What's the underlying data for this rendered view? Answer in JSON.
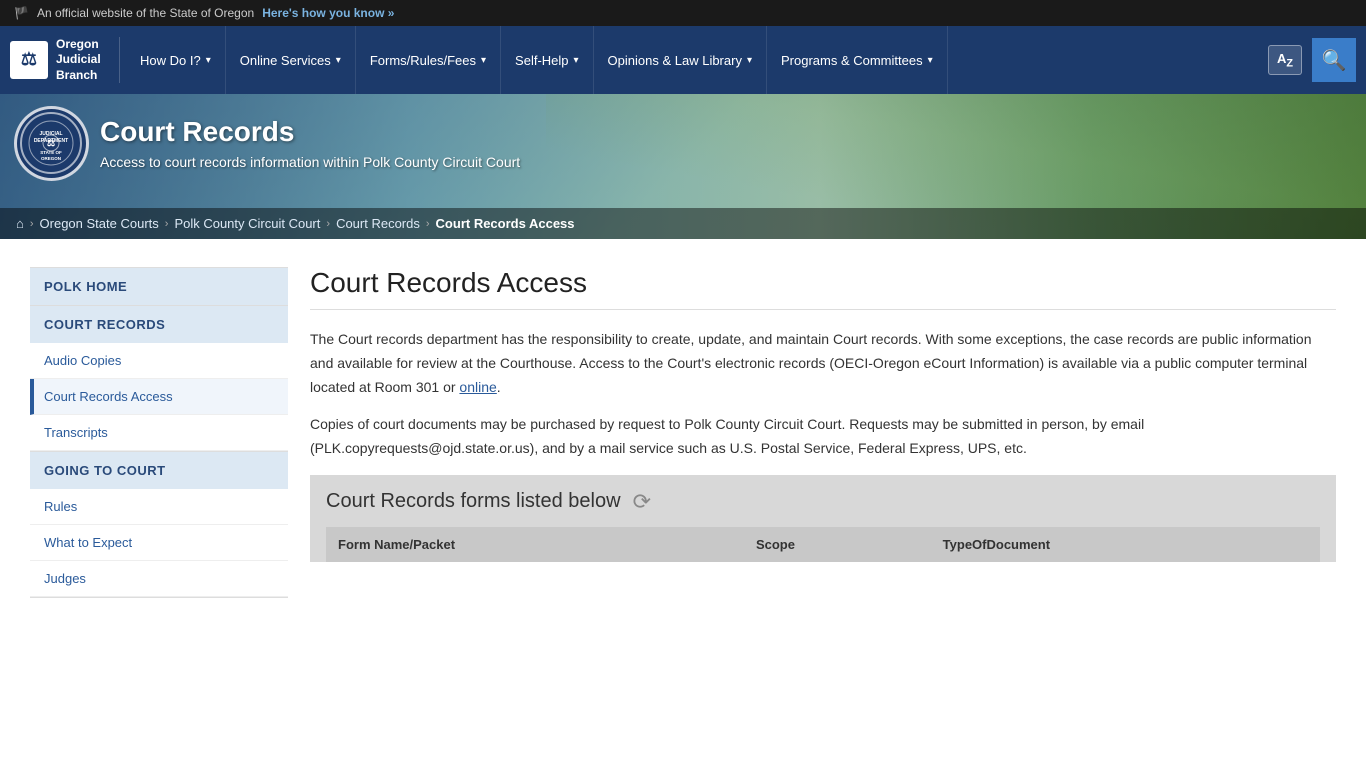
{
  "topBanner": {
    "text": "An official website of the State of Oregon",
    "linkText": "Here's how you know »",
    "flagEmoji": "🏴"
  },
  "navbar": {
    "logo": {
      "line1": "Oregon",
      "line2": "Judicial",
      "line3": "Branch",
      "iconText": "⚖"
    },
    "items": [
      {
        "label": "How Do I?",
        "hasDropdown": true
      },
      {
        "label": "Online Services",
        "hasDropdown": true
      },
      {
        "label": "Forms/Rules/Fees",
        "hasDropdown": true
      },
      {
        "label": "Self-Help",
        "hasDropdown": true
      },
      {
        "label": "Opinions & Law Library",
        "hasDropdown": true
      },
      {
        "label": "Programs & Committees",
        "hasDropdown": true
      }
    ],
    "translateLabel": "A",
    "translateSub": "Z",
    "searchIcon": "🔍"
  },
  "hero": {
    "sealText": "JUDICIAL DEPARTMENT STATE OF OREGON",
    "title": "Court Records",
    "subtitle": "Access to court records information within Polk County Circuit Court"
  },
  "breadcrumb": {
    "homeIcon": "⌂",
    "items": [
      {
        "label": "Oregon State Courts",
        "link": true
      },
      {
        "label": "Polk County Circuit Court",
        "link": true
      },
      {
        "label": "Court Records",
        "link": true
      },
      {
        "label": "Court Records Access",
        "current": true
      }
    ]
  },
  "pageTitle": "Court Records Access",
  "sidebar": {
    "sections": [
      {
        "header": "POLK HOME",
        "links": []
      },
      {
        "header": "COURT RECORDS",
        "links": [
          {
            "label": "Audio Copies",
            "active": false
          },
          {
            "label": "Court Records Access",
            "active": true
          },
          {
            "label": "Transcripts",
            "active": false
          }
        ]
      },
      {
        "header": "GOING TO COURT",
        "links": [
          {
            "label": "Rules",
            "active": false
          },
          {
            "label": "What to Expect",
            "active": false
          },
          {
            "label": "Judges",
            "active": false
          }
        ]
      }
    ]
  },
  "content": {
    "paragraph1": "The Court records department has the responsibility to create, update, and maintain Court records. With some exceptions, the case records are public information and available for review at the Courthouse. Access to the Court's electronic records (OECI-Oregon eCourt Information) is available via a public computer terminal located at Room 301 or online.",
    "onlineLinkText": "online",
    "paragraph2": "Copies of court documents may be purchased by request to Polk County Circuit Court. Requests may be submitted in person, by email (PLK.copyrequests@ojd.state.or.us), and by a mail service such as U.S. Postal Service, Federal Express, UPS, etc.",
    "formsSection": {
      "title": "Court Records forms listed below",
      "tableHeaders": [
        "Form Name/Packet",
        "Scope",
        "TypeOfDocument"
      ],
      "rows": []
    }
  }
}
